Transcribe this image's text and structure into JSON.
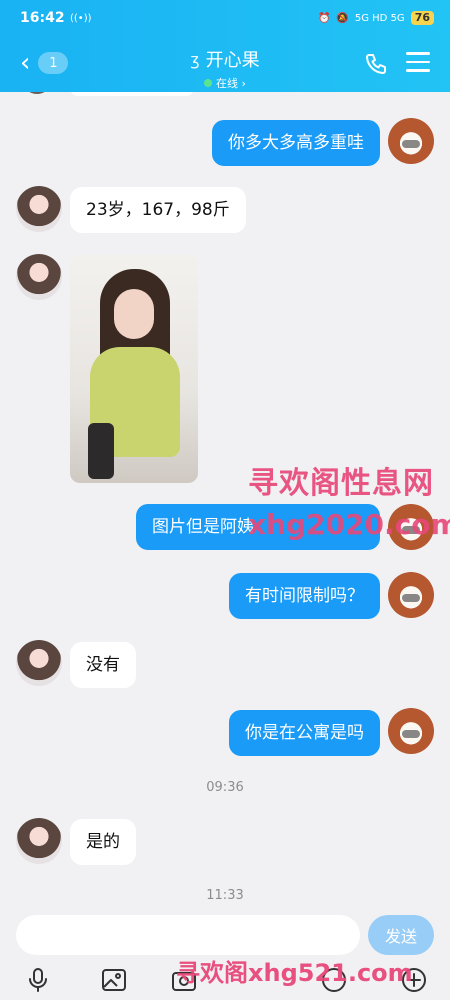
{
  "status_bar": {
    "time": "16:42",
    "network_labels": "5G HD 5G",
    "battery": "76"
  },
  "header": {
    "unread_count": "1",
    "contact_name": "开心果",
    "online_status": "在线 ›"
  },
  "messages": [
    {
      "sender": "me",
      "text": "你多大多高多重哇"
    },
    {
      "sender": "her",
      "text": "23岁，167，98斤"
    },
    {
      "sender": "her",
      "type": "image"
    },
    {
      "sender": "me",
      "text": "图片但是阿姨"
    },
    {
      "sender": "me",
      "text": "有时间限制吗？"
    },
    {
      "sender": "her",
      "text": "没有"
    },
    {
      "sender": "me",
      "text": "你是在公寓是吗"
    },
    {
      "type": "time",
      "text": "09:36"
    },
    {
      "sender": "her",
      "text": "是的"
    },
    {
      "type": "time",
      "text": "11:33"
    }
  ],
  "watermarks": {
    "line1": "寻欢阁性息网",
    "line2": "xhg2020.com",
    "line3": "寻欢阁xhg521.com"
  },
  "input": {
    "placeholder": "",
    "send_label": "发送"
  },
  "toolbar_icons": [
    "mic-icon",
    "image-icon",
    "camera-icon",
    "emoji-icon",
    "plus-icon"
  ]
}
